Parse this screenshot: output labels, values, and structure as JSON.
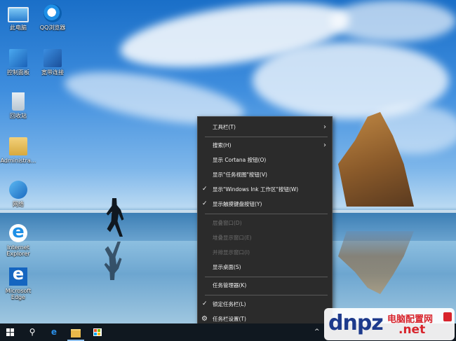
{
  "desktop": {
    "icons": [
      {
        "label": "此电脑",
        "icon": "this-pc-icon"
      },
      {
        "label": "QQ浏览器",
        "icon": "qq-browser-icon"
      },
      {
        "label": "控制面板",
        "icon": "control-panel-icon"
      },
      {
        "label": "宽带连接",
        "icon": "broadband-connection-icon"
      },
      {
        "label": "回收站",
        "icon": "recycle-bin-icon"
      },
      {
        "label": "Administra...",
        "icon": "user-folder-icon"
      },
      {
        "label": "网络",
        "icon": "network-icon"
      },
      {
        "label": "Internet\nExplorer",
        "icon": "internet-explorer-icon"
      },
      {
        "label": "Microsoft\nEdge",
        "icon": "edge-icon"
      }
    ]
  },
  "context_menu": {
    "items": [
      {
        "label": "工具栏(T)",
        "submenu": true
      },
      {
        "label": "搜索(H)",
        "submenu": true
      },
      {
        "label": "显示 Cortana 按钮(O)"
      },
      {
        "label": "显示\"任务视图\"按钮(V)"
      },
      {
        "label": "显示\"Windows Ink 工作区\"按钮(W)",
        "checked": true
      },
      {
        "label": "显示触摸键盘按钮(Y)",
        "checked": true
      },
      {
        "label": "层叠窗口(D)",
        "disabled": true
      },
      {
        "label": "堆叠显示窗口(E)",
        "disabled": true
      },
      {
        "label": "并排显示窗口(I)",
        "disabled": true
      },
      {
        "label": "显示桌面(S)"
      },
      {
        "label": "任务管理器(K)"
      },
      {
        "label": "锁定任务栏(L)",
        "checked": true
      },
      {
        "label": "任务栏设置(T)",
        "icon": "gear-icon"
      }
    ],
    "check_glyph": "✓",
    "submenu_glyph": "›"
  },
  "taskbar": {
    "buttons": [
      {
        "icon": "windows-start-icon"
      },
      {
        "icon": "search-icon",
        "glyph": "⚲"
      },
      {
        "icon": "edge-icon",
        "glyph": "e"
      },
      {
        "icon": "file-explorer-icon"
      },
      {
        "icon": "store-icon"
      }
    ],
    "tray_caret": "^",
    "colors": {
      "background": "#101820",
      "active_indicator": "#8ec0ee"
    }
  },
  "watermark": {
    "logo": "dnpz",
    "name": "电脑配置网",
    "domain": ".net"
  },
  "colors": {
    "menu_background": "#2b2b2b",
    "menu_text": "#f2f2f2",
    "menu_disabled_text": "#6d6d6d",
    "menu_separator": "#5a5a5a"
  }
}
